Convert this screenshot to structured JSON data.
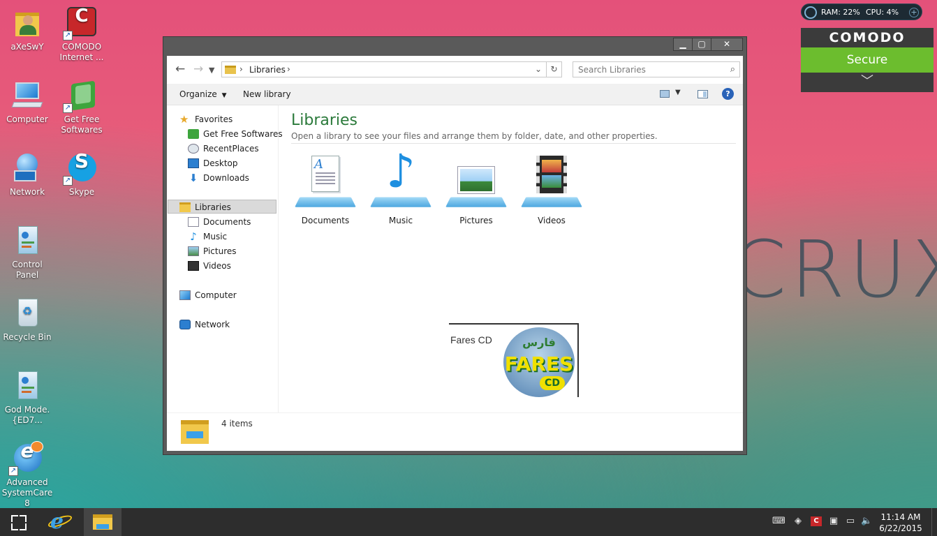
{
  "desktop": {
    "icons": [
      {
        "label": "aXeSwY",
        "icon": "user-folder-icon"
      },
      {
        "label": "COMODO Internet ...",
        "icon": "comodo-icon"
      },
      {
        "label": "Computer",
        "icon": "computer-icon"
      },
      {
        "label": "Get Free Softwares",
        "icon": "get-free-softwares-icon"
      },
      {
        "label": "Network",
        "icon": "network-icon"
      },
      {
        "label": "Skype",
        "icon": "skype-icon"
      },
      {
        "label": "Control Panel",
        "icon": "control-panel-icon"
      },
      {
        "label": "Recycle Bin",
        "icon": "recycle-bin-icon"
      },
      {
        "label": "God Mode.{ED7...",
        "icon": "god-mode-icon"
      },
      {
        "label": "Advanced SystemCare 8",
        "icon": "advanced-systemcare-icon"
      }
    ],
    "wallpaper_text": "CRUX"
  },
  "gadget": {
    "ram": "RAM: 22%",
    "cpu": "CPU: 4%",
    "brand": "COMODO",
    "status": "Secure",
    "status_color": "#6cbd2e"
  },
  "explorer": {
    "address": {
      "crumb": "Libraries"
    },
    "search": {
      "placeholder": "Search Libraries"
    },
    "toolbar": {
      "organize": "Organize",
      "new_library": "New library"
    },
    "nav": {
      "favorites": "Favorites",
      "favorites_items": [
        "Get Free Softwares",
        "RecentPlaces",
        "Desktop",
        "Downloads"
      ],
      "libraries": "Libraries",
      "libraries_items": [
        "Documents",
        "Music",
        "Pictures",
        "Videos"
      ],
      "computer": "Computer",
      "network": "Network"
    },
    "content": {
      "title": "Libraries",
      "subtitle": "Open a library to see your files and arrange them by folder, date, and other properties.",
      "libraries": [
        "Documents",
        "Music",
        "Pictures",
        "Videos"
      ]
    },
    "overlay": {
      "text": "Fares CD",
      "logo_text": "FARES",
      "logo_cd": "CD",
      "logo_arabic": "فارس"
    },
    "details": {
      "count": "4 items"
    },
    "title_color": "#2b7a3b"
  },
  "taskbar": {
    "time": "11:14 AM",
    "date": "6/22/2015"
  }
}
